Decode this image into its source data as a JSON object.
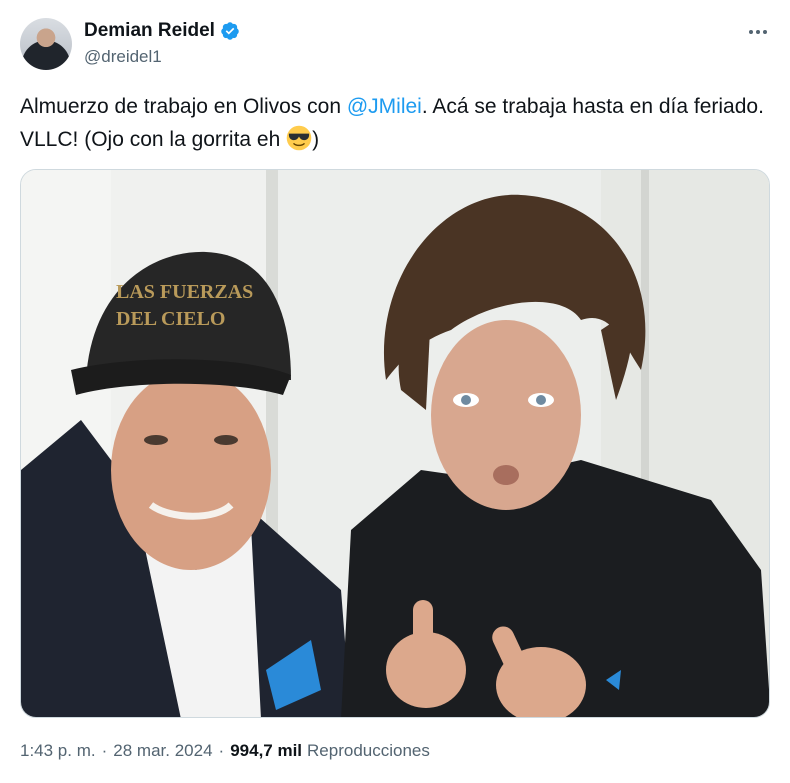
{
  "author": {
    "display_name": "Demian Reidel",
    "handle": "@dreidel1",
    "verified": true,
    "verified_color": "#1d9bf0"
  },
  "more_icon": "more-horizontal-icon",
  "tweet": {
    "text_before": "Almuerzo de trabajo en Olivos con ",
    "mention": "@JMilei",
    "text_after": ". Acá se trabaja hasta en día feriado. VLLC! (Ojo con la gorrita eh ",
    "emoji": "smiling-face-with-sunglasses",
    "text_end": ")"
  },
  "media": {
    "cap_text_line1": "LAS FUERZAS",
    "cap_text_line2": "DEL CIELO"
  },
  "meta": {
    "time": "1:43 p. m.",
    "separator": "·",
    "date": "28 mar. 2024",
    "separator2": "·",
    "views_count": "994,7 mil",
    "views_label": "Reproducciones"
  },
  "colors": {
    "text_primary": "#0f1419",
    "text_secondary": "#536471",
    "link": "#1d9bf0"
  }
}
